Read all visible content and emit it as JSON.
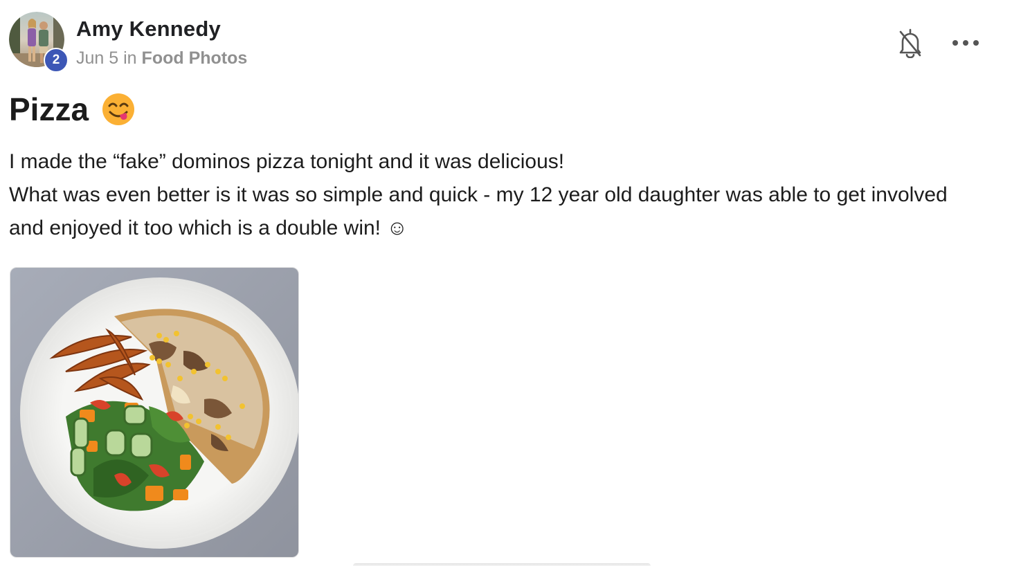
{
  "post": {
    "author": {
      "name": "Amy Kennedy",
      "level": "2"
    },
    "meta": {
      "date": "Jun 5",
      "in_word": "in",
      "category": "Food Photos"
    },
    "title": "Pizza",
    "title_emoji": "face-savoring-food",
    "body": {
      "line1": "I made the “fake” dominos pizza tonight and it was delicious!",
      "line2": "What was even better is it was so simple and quick - my 12 year old daughter was able to get involved and enjoyed it too which is a double win! ☺"
    },
    "actions": {
      "notification_icon": "bell-off-icon",
      "more_icon": "more-horizontal-icon"
    },
    "colors": {
      "level_badge": "#3d57b6",
      "meta_text": "#909090",
      "text": "#1c1c1c"
    }
  }
}
